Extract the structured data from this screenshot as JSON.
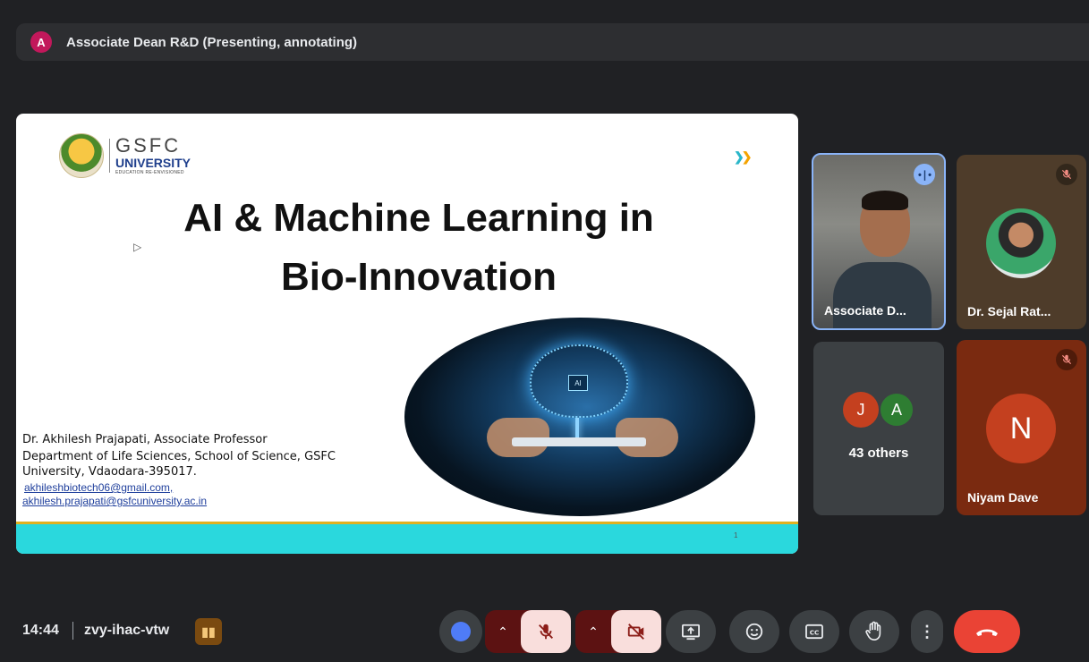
{
  "top_bar": {
    "avatar_letter": "A",
    "presenter_title": "Associate Dean R&D (Presenting, annotating)",
    "avatar_color": "#c2185b"
  },
  "slide": {
    "logo": {
      "name": "GSFC",
      "subtitle": "UNIVERSITY",
      "tagline": "EDUCATION RE-ENVISIONED"
    },
    "title_line1": "AI & Machine Learning in",
    "title_line2": "Bio-Innovation",
    "author_line1": "Dr. Akhilesh Prajapati, Associate Professor",
    "author_line2": "Department of Life Sciences, School of Science, GSFC University, Vdaodara-395017.",
    "email1": "akhileshbiotech06@gmail.com,",
    "email2": "akhilesh.prajapati@gsfcuniversity.ac.in",
    "page_number": "1",
    "footer_color": "#2ad8dd",
    "image_chip_label": "AI"
  },
  "participants": {
    "presenter_tile": {
      "name": "Associate D...",
      "status_icon": "speaking-icon"
    },
    "sejal_tile": {
      "name": "Dr. Sejal Rat...",
      "status_icon": "mic-off-icon"
    },
    "others_tile": {
      "avatar1": "J",
      "avatar2": "A",
      "label": "43 others"
    },
    "niyam_tile": {
      "avatar": "N",
      "name": "Niyam Dave",
      "status_icon": "mic-off-icon"
    }
  },
  "bottom_bar": {
    "time": "14:44",
    "meeting_code": "zvy-ihac-vtw",
    "controls": [
      "reactions-dot",
      "mic-options",
      "mic-off",
      "camera-options",
      "camera-off",
      "present-screen",
      "emoji-reactions",
      "captions",
      "raise-hand",
      "more-options",
      "leave-call"
    ],
    "end_color": "#ea4335"
  }
}
